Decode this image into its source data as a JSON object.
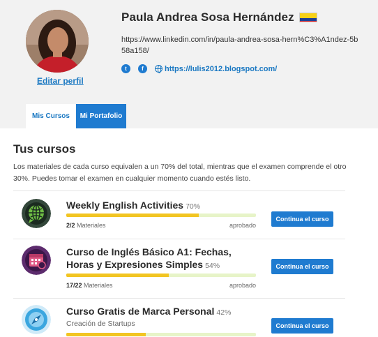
{
  "profile": {
    "name": "Paula Andrea Sosa Hernández",
    "linkedin_url": "https://www.linkedin.com/in/paula-andrea-sosa-hern%C3%A1ndez-5b58a158/",
    "blog_url": "https://lulis2012.blogspot.com/",
    "edit_label": "Editar perfil",
    "social_icons": [
      {
        "name": "twitter-icon",
        "glyph": "t"
      },
      {
        "name": "facebook-icon",
        "glyph": "f"
      },
      {
        "name": "globe-icon"
      }
    ],
    "flag": {
      "name": "colombia-flag",
      "colors": [
        "#f7d117",
        "#1f3f93",
        "#d9262b"
      ]
    }
  },
  "tabs": [
    {
      "label": "Mis Cursos",
      "active": true
    },
    {
      "label": "Mi Portafolio",
      "active": false
    }
  ],
  "section": {
    "title": "Tus cursos",
    "description": "Los materiales de cada curso equivalen a un 70% del total, mientras que el examen comprende el otro 30%. Puedes tomar el examen en cualquier momento cuando estés listo."
  },
  "courses": [
    {
      "title": "Weekly English Activities",
      "percent_label": "70%",
      "progress": 0.7,
      "materials_done": "2/2",
      "materials_label": "Materiales",
      "status": "aprobado",
      "button": "Continua el curso",
      "icon": "globe-chat-icon",
      "icon_bg": "#33473a"
    },
    {
      "title": "Curso de Inglés Básico A1: Fechas, Horas y Expresiones Simples",
      "percent_label": "54%",
      "progress": 0.54,
      "materials_done": "17/22",
      "materials_label": "Materiales",
      "status": "aprobado",
      "button": "Continua el curso",
      "icon": "calendar-icon",
      "icon_bg": "#5c2b6d"
    },
    {
      "title": "Curso Gratis de Marca Personal",
      "percent_label": "42%",
      "progress": 0.42,
      "subtitle": "Creación de Startups",
      "button": "Continua el curso",
      "icon": "compass-icon",
      "icon_bg": "#3aa6df"
    }
  ],
  "colors": {
    "accent": "#1f7bd0",
    "progress_fill": "#f2c522",
    "progress_track": "#e7f4c8"
  }
}
